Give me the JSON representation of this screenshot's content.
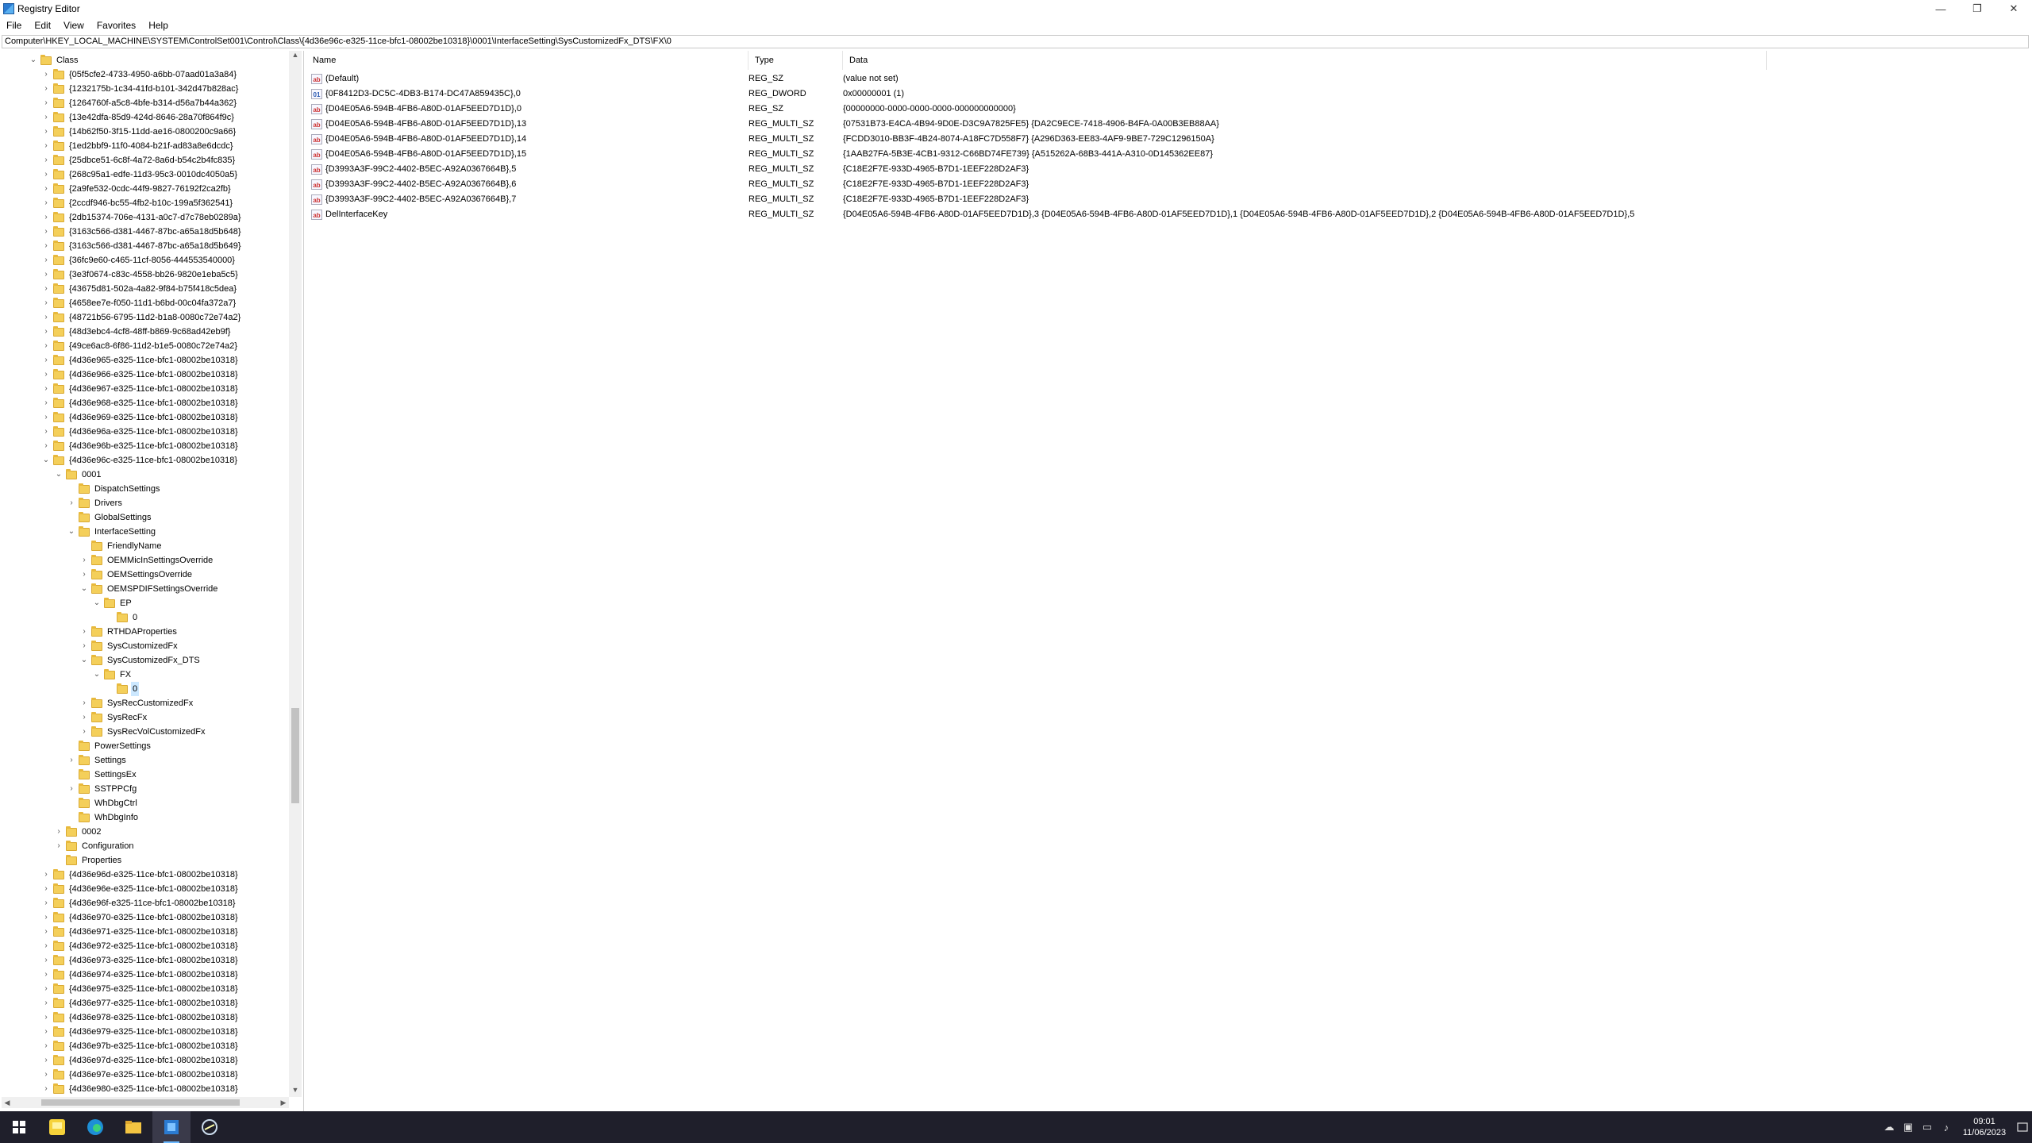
{
  "window": {
    "title": "Registry Editor",
    "minimize_glyph": "—",
    "maximize_glyph": "❐",
    "close_glyph": "✕"
  },
  "menu": [
    "File",
    "Edit",
    "View",
    "Favorites",
    "Help"
  ],
  "address": "Computer\\HKEY_LOCAL_MACHINE\\SYSTEM\\ControlSet001\\Control\\Class\\{4d36e96c-e325-11ce-bfc1-08002be10318}\\0001\\InterfaceSetting\\SysCustomizedFx_DTS\\FX\\0",
  "tree": [
    {
      "label": "Class",
      "level": 0,
      "chev": "v"
    },
    {
      "label": "{05f5cfe2-4733-4950-a6bb-07aad01a3a84}",
      "level": 1,
      "chev": ">"
    },
    {
      "label": "{1232175b-1c34-41fd-b101-342d47b828ac}",
      "level": 1,
      "chev": ">"
    },
    {
      "label": "{1264760f-a5c8-4bfe-b314-d56a7b44a362}",
      "level": 1,
      "chev": ">"
    },
    {
      "label": "{13e42dfa-85d9-424d-8646-28a70f864f9c}",
      "level": 1,
      "chev": ">"
    },
    {
      "label": "{14b62f50-3f15-11dd-ae16-0800200c9a66}",
      "level": 1,
      "chev": ">"
    },
    {
      "label": "{1ed2bbf9-11f0-4084-b21f-ad83a8e6dcdc}",
      "level": 1,
      "chev": ">"
    },
    {
      "label": "{25dbce51-6c8f-4a72-8a6d-b54c2b4fc835}",
      "level": 1,
      "chev": ">"
    },
    {
      "label": "{268c95a1-edfe-11d3-95c3-0010dc4050a5}",
      "level": 1,
      "chev": ">"
    },
    {
      "label": "{2a9fe532-0cdc-44f9-9827-76192f2ca2fb}",
      "level": 1,
      "chev": ">"
    },
    {
      "label": "{2ccdf946-bc55-4fb2-b10c-199a5f362541}",
      "level": 1,
      "chev": ">"
    },
    {
      "label": "{2db15374-706e-4131-a0c7-d7c78eb0289a}",
      "level": 1,
      "chev": ">"
    },
    {
      "label": "{3163c566-d381-4467-87bc-a65a18d5b648}",
      "level": 1,
      "chev": ">"
    },
    {
      "label": "{3163c566-d381-4467-87bc-a65a18d5b649}",
      "level": 1,
      "chev": ">"
    },
    {
      "label": "{36fc9e60-c465-11cf-8056-444553540000}",
      "level": 1,
      "chev": ">"
    },
    {
      "label": "{3e3f0674-c83c-4558-bb26-9820e1eba5c5}",
      "level": 1,
      "chev": ">"
    },
    {
      "label": "{43675d81-502a-4a82-9f84-b75f418c5dea}",
      "level": 1,
      "chev": ">"
    },
    {
      "label": "{4658ee7e-f050-11d1-b6bd-00c04fa372a7}",
      "level": 1,
      "chev": ">"
    },
    {
      "label": "{48721b56-6795-11d2-b1a8-0080c72e74a2}",
      "level": 1,
      "chev": ">"
    },
    {
      "label": "{48d3ebc4-4cf8-48ff-b869-9c68ad42eb9f}",
      "level": 1,
      "chev": ">"
    },
    {
      "label": "{49ce6ac8-6f86-11d2-b1e5-0080c72e74a2}",
      "level": 1,
      "chev": ">"
    },
    {
      "label": "{4d36e965-e325-11ce-bfc1-08002be10318}",
      "level": 1,
      "chev": ">"
    },
    {
      "label": "{4d36e966-e325-11ce-bfc1-08002be10318}",
      "level": 1,
      "chev": ">"
    },
    {
      "label": "{4d36e967-e325-11ce-bfc1-08002be10318}",
      "level": 1,
      "chev": ">"
    },
    {
      "label": "{4d36e968-e325-11ce-bfc1-08002be10318}",
      "level": 1,
      "chev": ">"
    },
    {
      "label": "{4d36e969-e325-11ce-bfc1-08002be10318}",
      "level": 1,
      "chev": ">"
    },
    {
      "label": "{4d36e96a-e325-11ce-bfc1-08002be10318}",
      "level": 1,
      "chev": ">"
    },
    {
      "label": "{4d36e96b-e325-11ce-bfc1-08002be10318}",
      "level": 1,
      "chev": ">"
    },
    {
      "label": "{4d36e96c-e325-11ce-bfc1-08002be10318}",
      "level": 1,
      "chev": "v"
    },
    {
      "label": "0001",
      "level": 2,
      "chev": "v"
    },
    {
      "label": "DispatchSettings",
      "level": 3,
      "chev": ""
    },
    {
      "label": "Drivers",
      "level": 3,
      "chev": ">"
    },
    {
      "label": "GlobalSettings",
      "level": 3,
      "chev": ""
    },
    {
      "label": "InterfaceSetting",
      "level": 3,
      "chev": "v"
    },
    {
      "label": "FriendlyName",
      "level": 4,
      "chev": ""
    },
    {
      "label": "OEMMicInSettingsOverride",
      "level": 4,
      "chev": ">"
    },
    {
      "label": "OEMSettingsOverride",
      "level": 4,
      "chev": ">"
    },
    {
      "label": "OEMSPDIFSettingsOverride",
      "level": 4,
      "chev": "v"
    },
    {
      "label": "EP",
      "level": 5,
      "chev": "v"
    },
    {
      "label": "0",
      "level": 6,
      "chev": ""
    },
    {
      "label": "RTHDAProperties",
      "level": 4,
      "chev": ">"
    },
    {
      "label": "SysCustomizedFx",
      "level": 4,
      "chev": ">"
    },
    {
      "label": "SysCustomizedFx_DTS",
      "level": 4,
      "chev": "v"
    },
    {
      "label": "FX",
      "level": 5,
      "chev": "v"
    },
    {
      "label": "0",
      "level": 6,
      "chev": "",
      "selected": true
    },
    {
      "label": "SysRecCustomizedFx",
      "level": 4,
      "chev": ">"
    },
    {
      "label": "SysRecFx",
      "level": 4,
      "chev": ">"
    },
    {
      "label": "SysRecVolCustomizedFx",
      "level": 4,
      "chev": ">"
    },
    {
      "label": "PowerSettings",
      "level": 3,
      "chev": ""
    },
    {
      "label": "Settings",
      "level": 3,
      "chev": ">"
    },
    {
      "label": "SettingsEx",
      "level": 3,
      "chev": ""
    },
    {
      "label": "SSTPPCfg",
      "level": 3,
      "chev": ">"
    },
    {
      "label": "WhDbgCtrl",
      "level": 3,
      "chev": ""
    },
    {
      "label": "WhDbgInfo",
      "level": 3,
      "chev": ""
    },
    {
      "label": "0002",
      "level": 2,
      "chev": ">"
    },
    {
      "label": "Configuration",
      "level": 2,
      "chev": ">"
    },
    {
      "label": "Properties",
      "level": 2,
      "chev": ""
    },
    {
      "label": "{4d36e96d-e325-11ce-bfc1-08002be10318}",
      "level": 1,
      "chev": ">"
    },
    {
      "label": "{4d36e96e-e325-11ce-bfc1-08002be10318}",
      "level": 1,
      "chev": ">"
    },
    {
      "label": "{4d36e96f-e325-11ce-bfc1-08002be10318}",
      "level": 1,
      "chev": ">"
    },
    {
      "label": "{4d36e970-e325-11ce-bfc1-08002be10318}",
      "level": 1,
      "chev": ">"
    },
    {
      "label": "{4d36e971-e325-11ce-bfc1-08002be10318}",
      "level": 1,
      "chev": ">"
    },
    {
      "label": "{4d36e972-e325-11ce-bfc1-08002be10318}",
      "level": 1,
      "chev": ">"
    },
    {
      "label": "{4d36e973-e325-11ce-bfc1-08002be10318}",
      "level": 1,
      "chev": ">"
    },
    {
      "label": "{4d36e974-e325-11ce-bfc1-08002be10318}",
      "level": 1,
      "chev": ">"
    },
    {
      "label": "{4d36e975-e325-11ce-bfc1-08002be10318}",
      "level": 1,
      "chev": ">"
    },
    {
      "label": "{4d36e977-e325-11ce-bfc1-08002be10318}",
      "level": 1,
      "chev": ">"
    },
    {
      "label": "{4d36e978-e325-11ce-bfc1-08002be10318}",
      "level": 1,
      "chev": ">"
    },
    {
      "label": "{4d36e979-e325-11ce-bfc1-08002be10318}",
      "level": 1,
      "chev": ">"
    },
    {
      "label": "{4d36e97b-e325-11ce-bfc1-08002be10318}",
      "level": 1,
      "chev": ">"
    },
    {
      "label": "{4d36e97d-e325-11ce-bfc1-08002be10318}",
      "level": 1,
      "chev": ">"
    },
    {
      "label": "{4d36e97e-e325-11ce-bfc1-08002be10318}",
      "level": 1,
      "chev": ">"
    },
    {
      "label": "{4d36e980-e325-11ce-bfc1-08002be10318}",
      "level": 1,
      "chev": ">"
    }
  ],
  "columns": {
    "name": "Name",
    "type": "Type",
    "data": "Data"
  },
  "values": [
    {
      "icon": "string",
      "name": "(Default)",
      "type": "REG_SZ",
      "data": "(value not set)"
    },
    {
      "icon": "binary",
      "name": "{0F8412D3-DC5C-4DB3-B174-DC47A859435C},0",
      "type": "REG_DWORD",
      "data": "0x00000001 (1)"
    },
    {
      "icon": "string",
      "name": "{D04E05A6-594B-4FB6-A80D-01AF5EED7D1D},0",
      "type": "REG_SZ",
      "data": "{00000000-0000-0000-0000-000000000000}"
    },
    {
      "icon": "string",
      "name": "{D04E05A6-594B-4FB6-A80D-01AF5EED7D1D},13",
      "type": "REG_MULTI_SZ",
      "data": "{07531B73-E4CA-4B94-9D0E-D3C9A7825FE5} {DA2C9ECE-7418-4906-B4FA-0A00B3EB88AA}"
    },
    {
      "icon": "string",
      "name": "{D04E05A6-594B-4FB6-A80D-01AF5EED7D1D},14",
      "type": "REG_MULTI_SZ",
      "data": "{FCDD3010-BB3F-4B24-8074-A18FC7D558F7} {A296D363-EE83-4AF9-9BE7-729C1296150A}"
    },
    {
      "icon": "string",
      "name": "{D04E05A6-594B-4FB6-A80D-01AF5EED7D1D},15",
      "type": "REG_MULTI_SZ",
      "data": "{1AAB27FA-5B3E-4CB1-9312-C66BD74FE739} {A515262A-68B3-441A-A310-0D145362EE87}"
    },
    {
      "icon": "string",
      "name": "{D3993A3F-99C2-4402-B5EC-A92A0367664B},5",
      "type": "REG_MULTI_SZ",
      "data": "{C18E2F7E-933D-4965-B7D1-1EEF228D2AF3}"
    },
    {
      "icon": "string",
      "name": "{D3993A3F-99C2-4402-B5EC-A92A0367664B},6",
      "type": "REG_MULTI_SZ",
      "data": "{C18E2F7E-933D-4965-B7D1-1EEF228D2AF3}"
    },
    {
      "icon": "string",
      "name": "{D3993A3F-99C2-4402-B5EC-A92A0367664B},7",
      "type": "REG_MULTI_SZ",
      "data": "{C18E2F7E-933D-4965-B7D1-1EEF228D2AF3}"
    },
    {
      "icon": "string",
      "name": "DelInterfaceKey",
      "type": "REG_MULTI_SZ",
      "data": "{D04E05A6-594B-4FB6-A80D-01AF5EED7D1D},3 {D04E05A6-594B-4FB6-A80D-01AF5EED7D1D},1 {D04E05A6-594B-4FB6-A80D-01AF5EED7D1D},2 {D04E05A6-594B-4FB6-A80D-01AF5EED7D1D},5"
    }
  ],
  "taskbar": {
    "apps": [
      "start-icon",
      "sticky-notes-icon",
      "edge-icon",
      "file-explorer-icon",
      "registry-editor-icon",
      "app-icon"
    ],
    "active": 4,
    "clock_time": "09:01",
    "clock_date": "11/06/2023"
  },
  "colors": {
    "selection": "#cce8ff",
    "taskbar": "#1f1f2b",
    "folder": "#f4cf5a"
  }
}
